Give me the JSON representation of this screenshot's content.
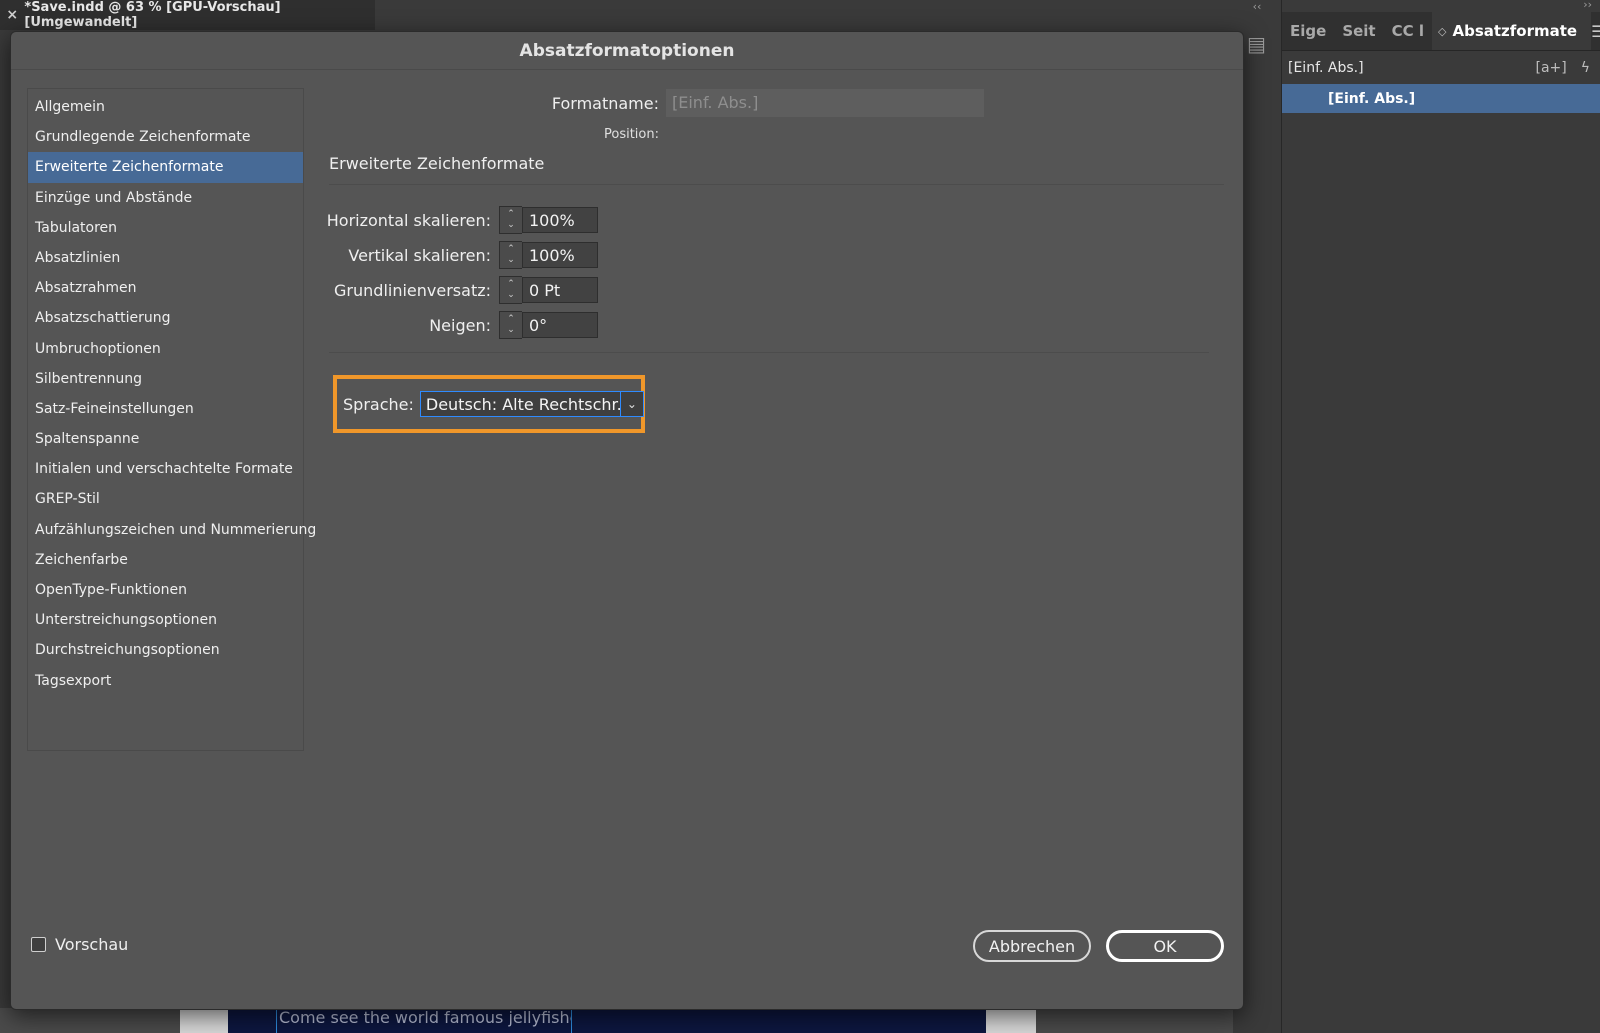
{
  "document_tab": {
    "close_icon": "×",
    "title": "*Save.indd @ 63 % [GPU-Vorschau] [Umgewandelt]"
  },
  "canvas": {
    "caption": "Come see the world famous jellyfishes"
  },
  "right_panel": {
    "tabs": [
      "Eige",
      "Seit",
      "CC l"
    ],
    "active_tab": "Absatzformate",
    "style_group": "[Einf. Abs.]",
    "selected_style": "[Einf. Abs.]",
    "icons": [
      "new-style-icon",
      "quick-apply-icon",
      "panel-menu-icon"
    ]
  },
  "dialog": {
    "title": "Absatzformatoptionen",
    "categories": [
      "Allgemein",
      "Grundlegende Zeichenformate",
      "Erweiterte Zeichenformate",
      "Einzüge und Abstände",
      "Tabulatoren",
      "Absatzlinien",
      "Absatzrahmen",
      "Absatzschattierung",
      "Umbruchoptionen",
      "Silbentrennung",
      "Satz-Feineinstellungen",
      "Spaltenspanne",
      "Initialen und verschachtelte Formate",
      "GREP-Stil",
      "Aufzählungszeichen und Nummerierung",
      "Zeichenfarbe",
      "OpenType-Funktionen",
      "Unterstreichungsoptionen",
      "Durchstreichungsoptionen",
      "Tagsexport"
    ],
    "selected_category": "Erweiterte Zeichenformate",
    "formatname_label": "Formatname:",
    "formatname_value": "[Einf. Abs.]",
    "position_label": "Position:",
    "section_title": "Erweiterte Zeichenformate",
    "fields": [
      {
        "label": "Horizontal skalieren:",
        "value": "100%"
      },
      {
        "label": "Vertikal skalieren:",
        "value": "100%"
      },
      {
        "label": "Grundlinienversatz:",
        "value": "0 Pt"
      },
      {
        "label": "Neigen:",
        "value": "0°"
      }
    ],
    "language_label": "Sprache:",
    "language_value": "Deutsch: Alte Rechtschr...",
    "preview_label": "Vorschau",
    "preview_checked": false,
    "cancel_label": "Abbrechen",
    "ok_label": "OK",
    "highlight_color": "#f0972a",
    "selection_color": "#476a96"
  }
}
